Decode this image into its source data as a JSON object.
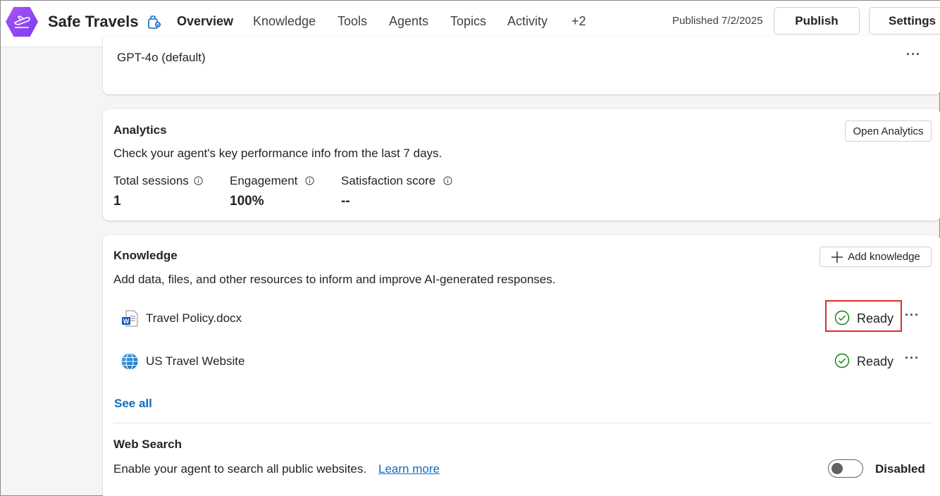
{
  "header": {
    "app_title": "Safe Travels",
    "tabs": [
      {
        "label": "Overview",
        "active": true
      },
      {
        "label": "Knowledge"
      },
      {
        "label": "Tools"
      },
      {
        "label": "Agents"
      },
      {
        "label": "Topics"
      },
      {
        "label": "Activity"
      },
      {
        "label": "+2"
      }
    ],
    "published_text": "Published 7/2/2025",
    "publish_label": "Publish",
    "settings_label": "Settings"
  },
  "model_card": {
    "model_value": "GPT-4o (default)",
    "more_label": "···"
  },
  "analytics": {
    "title": "Analytics",
    "description": "Check your agent's key performance info from the last 7 days.",
    "open_button": "Open Analytics",
    "metrics": [
      {
        "label": "Total sessions",
        "value": "1"
      },
      {
        "label": "Engagement",
        "value": "100%"
      },
      {
        "label": "Satisfaction score",
        "value": "--"
      }
    ]
  },
  "knowledge": {
    "title": "Knowledge",
    "add_button": "Add knowledge",
    "description": "Add data, files, and other resources to inform and improve AI-generated responses.",
    "items": [
      {
        "name": "Travel Policy.docx",
        "icon": "word-doc-icon",
        "status": "Ready",
        "more": "···"
      },
      {
        "name": "US Travel Website",
        "icon": "globe-icon",
        "status": "Ready",
        "more": "···"
      }
    ],
    "see_all": "See all"
  },
  "web_search": {
    "title": "Web Search",
    "description": "Enable your agent to search all public websites.",
    "learn_more": "Learn more",
    "toggle_state": "Disabled"
  },
  "colors": {
    "accent": "#0f6cbd",
    "success": "#107c10",
    "highlight": "#d92c2c",
    "brand_purple": "#8b3ff0"
  }
}
